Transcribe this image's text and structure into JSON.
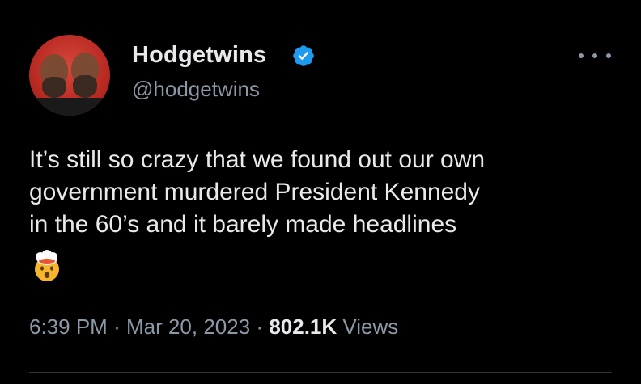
{
  "author": {
    "display_name": "Hodgetwins",
    "handle": "@hodgetwins",
    "verified_icon": "verified-badge-icon",
    "avatar_icon": "avatar-photo"
  },
  "tweet": {
    "text": "It’s still so crazy that we found out our own\ngovernment murdered President Kennedy\nin the 60’s and it barely made headlines",
    "emoji": "exploding-head-emoji"
  },
  "meta": {
    "time": "6:39 PM",
    "separator": "·",
    "date": "Mar 20, 2023",
    "views_count": "802.1K",
    "views_label": "Views"
  },
  "colors": {
    "background": "#000000",
    "primary_text": "#e7e9ea",
    "secondary_text": "#8b98a5",
    "verified_blue": "#1d9bf0"
  }
}
